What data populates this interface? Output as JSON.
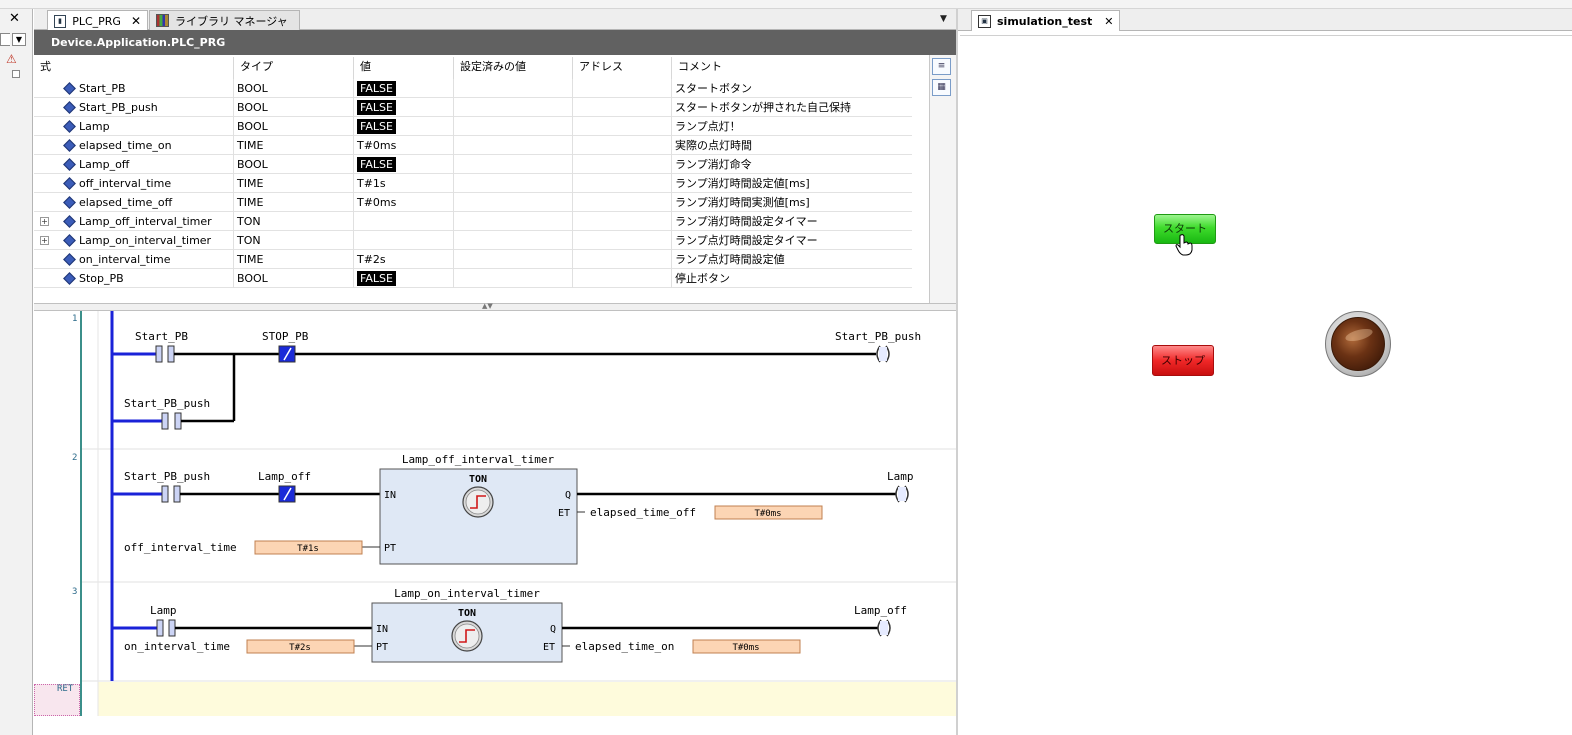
{
  "colors": {
    "header_bg": "#616161",
    "rail_blue": "#1a22d8",
    "wire_black": "#000000",
    "value_box_bg": "#fcd5b4",
    "fb_bg": "#dfe8f5",
    "start_button": "#3fdb2c",
    "stop_button": "#f02828",
    "lamp": "#6b3214"
  },
  "left_panel": {
    "close": "✕",
    "dropdown": "▼",
    "warning": "⚠"
  },
  "tabs": [
    {
      "label": "PLC_PRG",
      "close": "✕",
      "icon": "plc-program-icon"
    },
    {
      "label": "ライブラリ マネージャ",
      "icon": "library-manager-icon"
    }
  ],
  "tab_dropdown": "▼",
  "right_tab": {
    "label": "simulation_test",
    "close": "✕",
    "icon": "visualization-icon"
  },
  "header": {
    "title": "Device.Application.PLC_PRG"
  },
  "var_table": {
    "columns": [
      "式",
      "タイプ",
      "値",
      "設定済みの値",
      "アドレス",
      "コメント"
    ],
    "rows": [
      {
        "expand": "",
        "name": "Start_PB",
        "type": "BOOL",
        "value": "FALSE",
        "value_is_bool": true,
        "prepared": "",
        "address": "",
        "comment": "スタートボタン"
      },
      {
        "expand": "",
        "name": "Start_PB_push",
        "type": "BOOL",
        "value": "FALSE",
        "value_is_bool": true,
        "prepared": "",
        "address": "",
        "comment": "スタートボタンが押された自己保持"
      },
      {
        "expand": "",
        "name": "Lamp",
        "type": "BOOL",
        "value": "FALSE",
        "value_is_bool": true,
        "prepared": "",
        "address": "",
        "comment": "ランプ点灯！"
      },
      {
        "expand": "",
        "name": "elapsed_time_on",
        "type": "TIME",
        "value": "T#0ms",
        "value_is_bool": false,
        "prepared": "",
        "address": "",
        "comment": "実際の点灯時間"
      },
      {
        "expand": "",
        "name": "Lamp_off",
        "type": "BOOL",
        "value": "FALSE",
        "value_is_bool": true,
        "prepared": "",
        "address": "",
        "comment": "ランプ消灯命令"
      },
      {
        "expand": "",
        "name": "off_interval_time",
        "type": "TIME",
        "value": "T#1s",
        "value_is_bool": false,
        "prepared": "",
        "address": "",
        "comment": "ランプ消灯時間設定値[ms]"
      },
      {
        "expand": "",
        "name": "elapsed_time_off",
        "type": "TIME",
        "value": "T#0ms",
        "value_is_bool": false,
        "prepared": "",
        "address": "",
        "comment": "ランプ消灯時間実測値[ms]"
      },
      {
        "expand": "+",
        "name": "Lamp_off_interval_timer",
        "type": "TON",
        "value": "",
        "value_is_bool": false,
        "prepared": "",
        "address": "",
        "comment": "ランプ消灯時間設定タイマー"
      },
      {
        "expand": "+",
        "name": "Lamp_on_interval_timer",
        "type": "TON",
        "value": "",
        "value_is_bool": false,
        "prepared": "",
        "address": "",
        "comment": "ランプ点灯時間設定タイマー"
      },
      {
        "expand": "",
        "name": "on_interval_time",
        "type": "TIME",
        "value": "T#2s",
        "value_is_bool": false,
        "prepared": "",
        "address": "",
        "comment": "ランプ点灯時間設定値"
      },
      {
        "expand": "",
        "name": "Stop_PB",
        "type": "BOOL",
        "value": "FALSE",
        "value_is_bool": true,
        "prepared": "",
        "address": "",
        "comment": "停止ボタン"
      }
    ]
  },
  "side_buttons": [
    "declaration-text-view-icon",
    "declaration-table-view-icon"
  ],
  "ladder": {
    "networks": [
      {
        "number": "1",
        "contact1": "Start_PB",
        "contact2": "STOP_PB",
        "coil": "Start_PB_push",
        "branch_contact": "Start_PB_push"
      },
      {
        "number": "2",
        "contact1": "Start_PB_push",
        "contact2": "Lamp_off",
        "fb_instance": "Lamp_off_interval_timer",
        "fb_type": "TON",
        "pin_in": "IN",
        "pin_pt": "PT",
        "pin_q": "Q",
        "pin_et": "ET",
        "pt_var": "off_interval_time",
        "pt_value": "T#1s",
        "et_var": "elapsed_time_off",
        "et_value": "T#0ms",
        "coil": "Lamp"
      },
      {
        "number": "3",
        "contact1": "Lamp",
        "fb_instance": "Lamp_on_interval_timer",
        "fb_type": "TON",
        "pin_in": "IN",
        "pin_pt": "PT",
        "pin_q": "Q",
        "pin_et": "ET",
        "pt_var": "on_interval_time",
        "pt_value": "T#2s",
        "et_var": "elapsed_time_on",
        "et_value": "T#0ms",
        "coil": "Lamp_off"
      }
    ],
    "ret_label": "RET"
  },
  "visu": {
    "start_label": "スタート",
    "stop_label": "ストップ"
  }
}
